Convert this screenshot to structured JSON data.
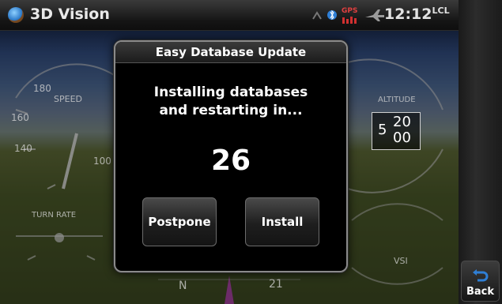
{
  "titlebar": {
    "title": "3D Vision",
    "gps_label": "GPS",
    "clock": "12:12",
    "clock_suffix": "LCL"
  },
  "background": {
    "speed_label": "SPEED",
    "altitude_label": "ALTITUDE",
    "vsi_label": "VSI",
    "turn_rate_label": "TURN RATE",
    "speed_ticks": [
      "180",
      "160",
      "140",
      "100"
    ],
    "altitude_readout_top": "20",
    "altitude_readout_mid": "5",
    "altitude_readout_bottom": "00",
    "heading_n": "N",
    "heading_21": "21"
  },
  "modal": {
    "title": "Easy Database Update",
    "message_line1": "Installing databases",
    "message_line2": "and restarting in...",
    "countdown": "26",
    "postpone_label": "Postpone",
    "install_label": "Install"
  },
  "sidebar": {
    "back_label": "Back"
  },
  "colors": {
    "accent_blue": "#2f7fd6",
    "gps_red": "#d03030",
    "text": "#ffffff"
  }
}
